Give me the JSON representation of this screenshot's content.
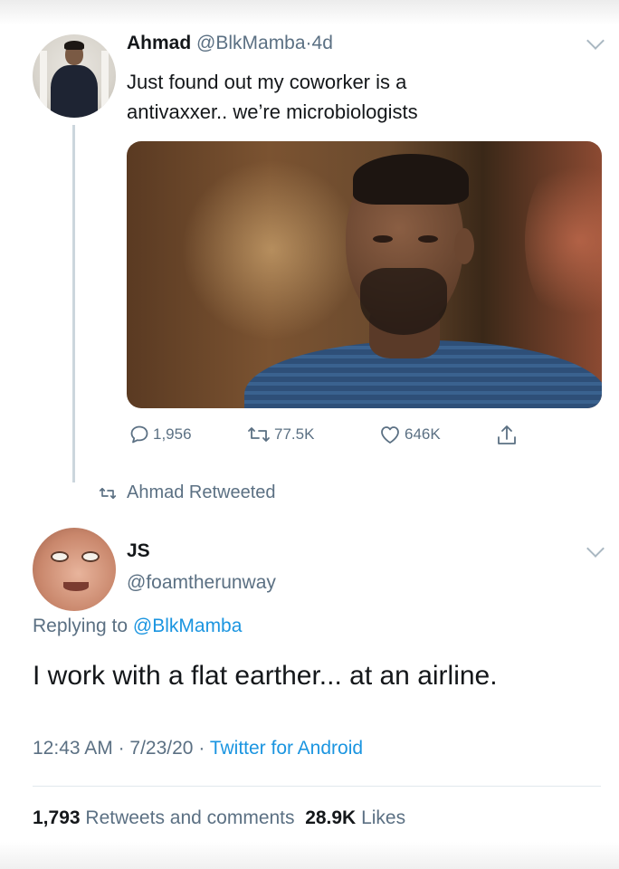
{
  "tweet1": {
    "name": "Ahmad",
    "handle": "@BlkMamba",
    "separator": "·",
    "time": "4d",
    "text_line1": "Just found out my coworker is a",
    "text_line2": "antivaxxer.. we’re microbiologists",
    "replies": "1,956",
    "retweets": "77.5K",
    "likes": "646K"
  },
  "retweet_notice": "Ahmad Retweeted",
  "tweet2": {
    "name": "JS",
    "handle": "@foamtherunway",
    "replying_prefix": "Replying to",
    "replying_to": "@BlkMamba",
    "text": "I work with a flat earther... at an airline.",
    "time": "12:43 AM",
    "date": "7/23/20",
    "source": "Twitter for Android",
    "separator": "·",
    "retweets_count": "1,793",
    "retweets_label": "Retweets and comments",
    "likes_count": "28.9K",
    "likes_label": "Likes"
  },
  "colors": {
    "text": "#14171a",
    "secondary": "#5b7083",
    "link": "#1b95e0",
    "thread_line": "#ccd6dd"
  },
  "icons": [
    "chevron-down-icon",
    "reply-icon",
    "retweet-icon",
    "like-icon",
    "share-icon"
  ]
}
